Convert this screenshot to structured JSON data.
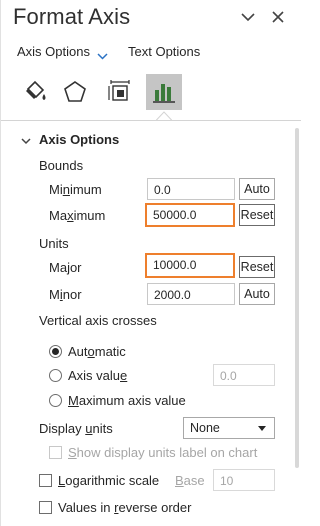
{
  "pane": {
    "title": "Format Axis",
    "tabs": [
      {
        "label": "Axis Options",
        "active": true
      },
      {
        "label": "Text Options",
        "active": false
      }
    ],
    "icon_tabs": [
      "fill-line-icon",
      "effects-icon",
      "size-properties-icon",
      "axis-options-icon"
    ]
  },
  "axis_options": {
    "section_title": "Axis Options",
    "bounds": {
      "heading": "Bounds",
      "minimum": {
        "label": "Minimum",
        "value": "0.0",
        "button": "Auto"
      },
      "maximum": {
        "label": "Maximum",
        "value": "50000.0",
        "button": "Reset"
      }
    },
    "units": {
      "heading": "Units",
      "major": {
        "label": "Major",
        "value": "10000.0",
        "button": "Reset"
      },
      "minor": {
        "label": "Minor",
        "value": "2000.0",
        "button": "Auto"
      }
    },
    "vertical_axis_crosses": {
      "heading": "Vertical axis crosses",
      "options": [
        {
          "label": "Automatic",
          "selected": true
        },
        {
          "label": "Axis value",
          "selected": false,
          "value": "0.0"
        },
        {
          "label": "Maximum axis value",
          "selected": false
        }
      ]
    },
    "display_units": {
      "label": "Display units",
      "value": "None",
      "show_label_text": "Show display units label on chart"
    },
    "logarithmic_scale": {
      "label": "Logarithmic scale",
      "checked": false,
      "base_label": "Base",
      "base_value": "10"
    },
    "values_reverse": {
      "label": "Values in reverse order",
      "checked": false
    }
  },
  "colors": {
    "highlight": "#ee7f2d",
    "selected_tab": "#c5c5c5",
    "tab_chevron": "#2b72c4"
  }
}
